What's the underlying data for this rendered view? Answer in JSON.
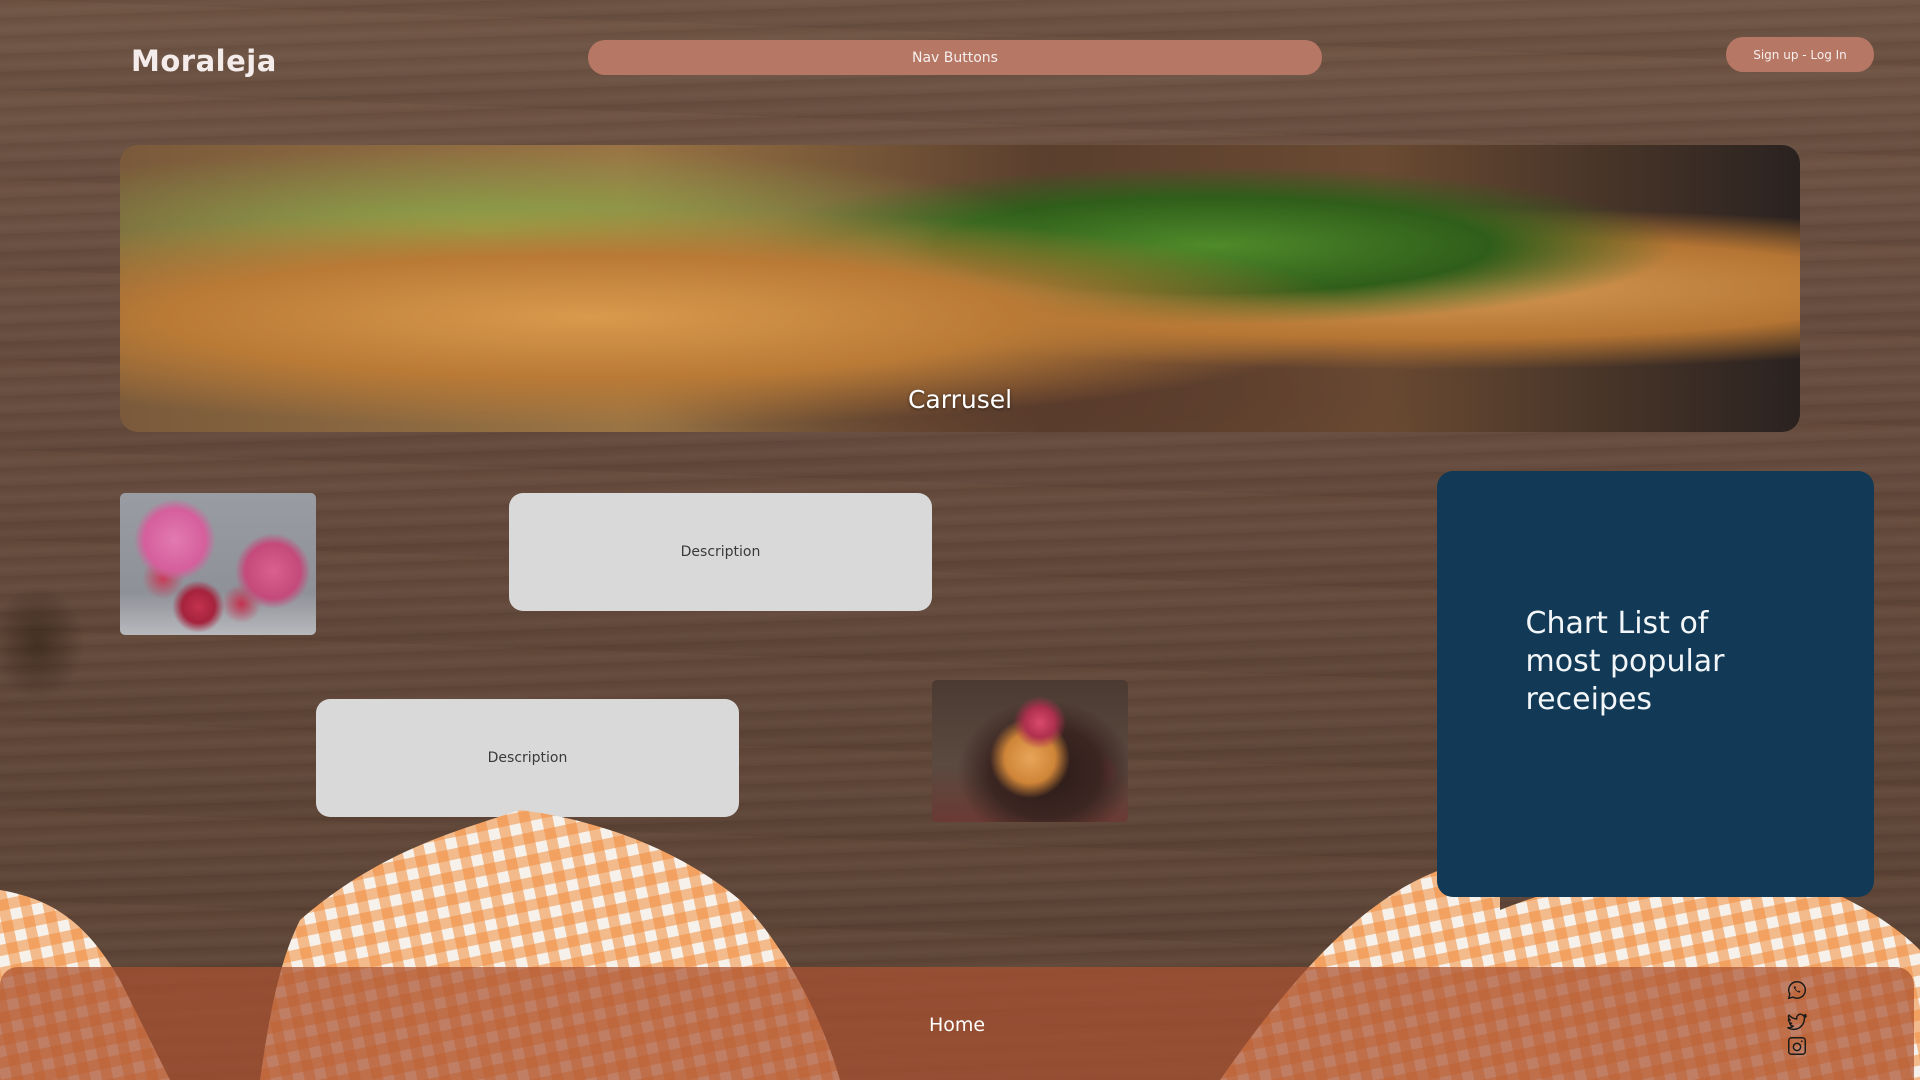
{
  "brand": {
    "logo_text": "Moraleja"
  },
  "header": {
    "nav_label": "Nav Buttons",
    "auth_label": "Sign up - Log In"
  },
  "carousel": {
    "label": "Carrusel"
  },
  "cards": [
    {
      "description": "Description"
    },
    {
      "description": "Description"
    }
  ],
  "chart_panel": {
    "text": "Chart List of most popular receipes"
  },
  "footer": {
    "home_label": "Home",
    "social_icons": [
      "whatsapp-icon",
      "twitter-icon",
      "instagram-icon"
    ]
  },
  "colors": {
    "nav_accent": "#b67765",
    "chart_panel_bg": "#123a56",
    "card_bg": "#d9d9d9",
    "footer_bg": "#aa5230"
  }
}
